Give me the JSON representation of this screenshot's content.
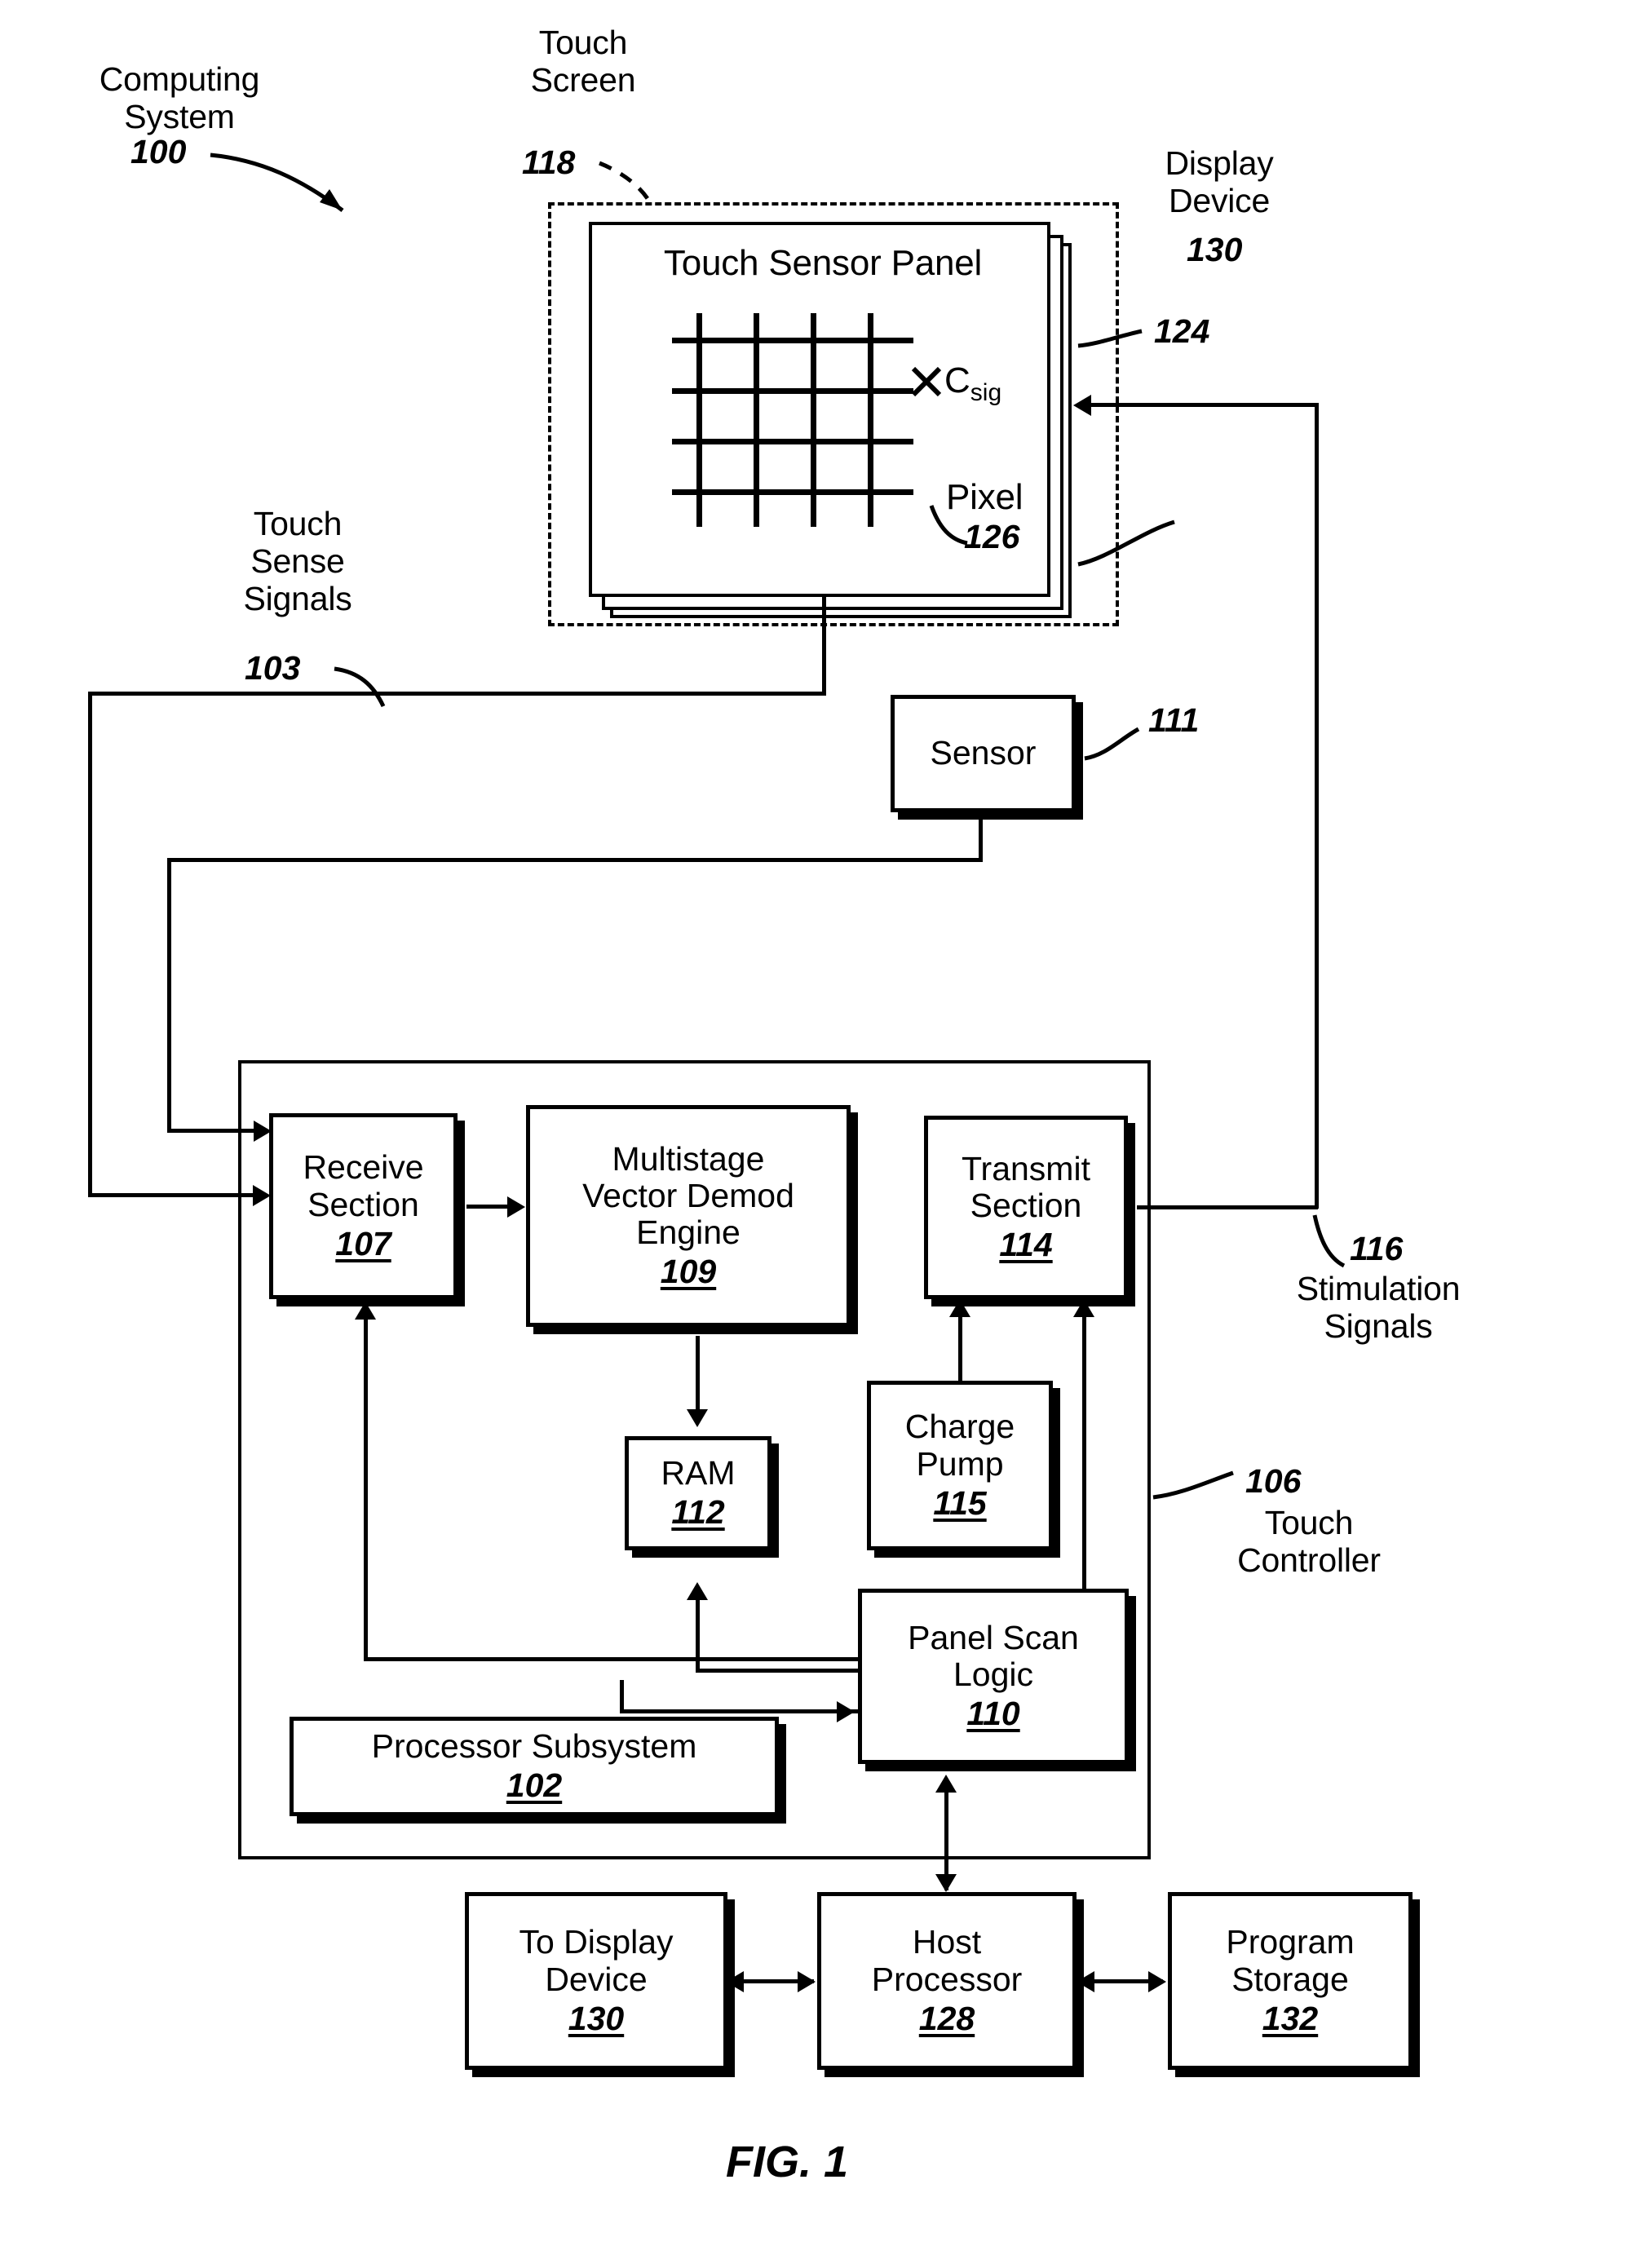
{
  "figure": {
    "caption": "FIG. 1",
    "system_label": "Computing\nSystem",
    "system_ref": "100"
  },
  "touch_screen": {
    "label": "Touch\nScreen",
    "ref": "118"
  },
  "display_device": {
    "label": "Display\nDevice",
    "ref": "130"
  },
  "panel_stack": {
    "layer_ref": "124"
  },
  "touch_sensor_panel": {
    "title": "Touch Sensor Panel",
    "csig_label": "C",
    "csig_sub": "sig",
    "pixel_label": "Pixel",
    "pixel_ref": "126",
    "grid": {
      "rows": 4,
      "cols": 4
    }
  },
  "touch_sense_signals": {
    "label": "Touch\nSense\nSignals",
    "ref": "103"
  },
  "stimulation_signals": {
    "ref": "116",
    "label": "Stimulation\nSignals"
  },
  "sensor": {
    "title": "Sensor",
    "ref": "111"
  },
  "touch_controller": {
    "ref": "106",
    "label": "Touch\nController",
    "blocks": [
      {
        "id": "receive_section",
        "title": "Receive\nSection",
        "num": "107"
      },
      {
        "id": "demod_engine",
        "title": "Multistage\nVector Demod\nEngine",
        "num": "109"
      },
      {
        "id": "transmit_section",
        "title": "Transmit\nSection",
        "num": "114"
      },
      {
        "id": "ram",
        "title": "RAM",
        "num": "112"
      },
      {
        "id": "charge_pump",
        "title": "Charge\nPump",
        "num": "115"
      },
      {
        "id": "panel_scan_logic",
        "title": "Panel Scan\nLogic",
        "num": "110"
      },
      {
        "id": "processor_subsystem",
        "title": "Processor Subsystem",
        "num": "102"
      }
    ]
  },
  "bottom_row": [
    {
      "id": "to_display_device",
      "title": "To Display\nDevice",
      "num": "130"
    },
    {
      "id": "host_processor",
      "title": "Host\nProcessor",
      "num": "128"
    },
    {
      "id": "program_storage",
      "title": "Program\nStorage",
      "num": "132"
    }
  ]
}
